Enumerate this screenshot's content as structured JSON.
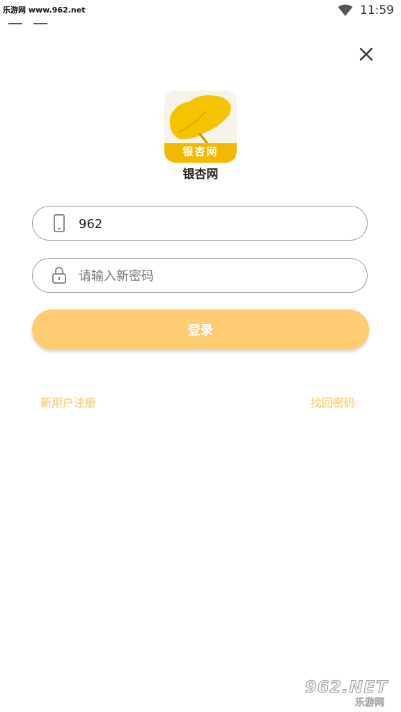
{
  "status_bar": {
    "watermark": "乐游网 www.962.net",
    "time": "11:59"
  },
  "app": {
    "logo_text": "银杏网",
    "name": "银杏网"
  },
  "form": {
    "phone_value": "962",
    "password_placeholder": "请输入新密码",
    "login_label": "登录"
  },
  "links": {
    "register": "新用户注册",
    "forgot_password": "找回密码"
  },
  "brand": {
    "top": "962.NET",
    "bottom": "乐游网"
  },
  "colors": {
    "accent": "#ffcc73",
    "link": "#ffd58a",
    "logo_yellow": "#f5c400"
  }
}
